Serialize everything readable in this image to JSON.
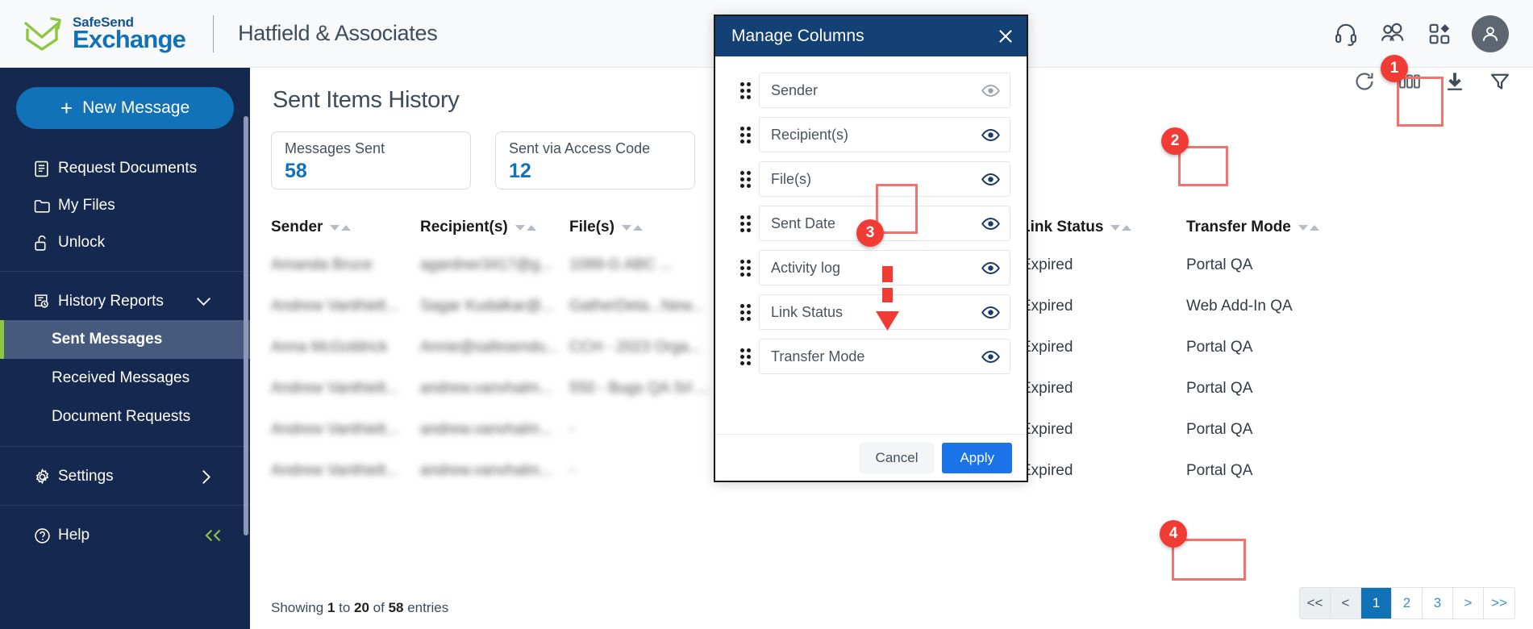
{
  "header": {
    "brand_line1": "SafeSend",
    "brand_line2": "Exchange",
    "org_name": "Hatfield & Associates",
    "icons": [
      "headset-icon",
      "users-icon",
      "apps-grid-icon",
      "avatar-icon"
    ]
  },
  "sidebar": {
    "new_message_label": "New Message",
    "items": [
      {
        "label": "Request Documents",
        "icon": "document-icon"
      },
      {
        "label": "My Files",
        "icon": "folder-icon"
      },
      {
        "label": "Unlock",
        "icon": "unlock-icon"
      }
    ],
    "history_group": {
      "label": "History Reports",
      "icon": "history-report-icon",
      "chevron": "chevron-down-icon",
      "children": [
        {
          "label": "Sent Messages",
          "active": true
        },
        {
          "label": "Received Messages",
          "active": false
        },
        {
          "label": "Document Requests",
          "active": false
        }
      ]
    },
    "settings": {
      "label": "Settings",
      "icon": "gear-icon",
      "chevron": "chevron-right-icon"
    },
    "help": {
      "label": "Help",
      "icon": "question-circle-icon",
      "collapse": "double-chevron-left-icon"
    }
  },
  "main": {
    "page_title": "Sent Items History",
    "stats": [
      {
        "label": "Messages Sent",
        "value": "58"
      },
      {
        "label": "Sent via Access Code",
        "value": "12"
      }
    ],
    "toolbar": [
      {
        "name": "refresh-icon"
      },
      {
        "name": "manage-columns-icon"
      },
      {
        "name": "download-icon"
      },
      {
        "name": "filter-icon"
      }
    ],
    "table": {
      "columns": [
        "Sender",
        "Recipient(s)",
        "File(s)",
        "Link Status",
        "Transfer Mode"
      ],
      "rows": [
        {
          "sender": "Amanda Bruce",
          "recipient": "agardner3417@g...",
          "files": "1099-G ABC ...",
          "link_status": "Expired",
          "transfer_mode": "Portal QA"
        },
        {
          "sender": "Andrew Vanthielt...",
          "recipient": "Sagar Kudalkar@...",
          "files": "GatherDeta...New...",
          "link_status": "Expired",
          "transfer_mode": "Web Add-In QA"
        },
        {
          "sender": "Anna McGoldrick",
          "recipient": "Annie@safesendu...",
          "files": "CCH - 2023 Orga...",
          "link_status": "Expired",
          "transfer_mode": "Portal QA"
        },
        {
          "sender": "Andrew Vanthielt...",
          "recipient": "andrew.vanvhalm...",
          "files": "550 - Bugs QA Srl ...",
          "link_status": "Expired",
          "transfer_mode": "Portal QA"
        },
        {
          "sender": "Andrew Vanthielt...",
          "recipient": "andrew.vanvhalm...",
          "files": "-",
          "link_status": "Expired",
          "transfer_mode": "Portal QA"
        },
        {
          "sender": "Andrew Vanthielt...",
          "recipient": "andrew.vanvhalm...",
          "files": "-",
          "link_status": "Expired",
          "transfer_mode": "Portal QA"
        }
      ]
    },
    "showing_text": {
      "prefix": "Showing ",
      "from": "1",
      "mid": " to ",
      "to": "20",
      "mid2": " of ",
      "total": "58",
      "suffix": " entries"
    },
    "pagination": {
      "first": "<<",
      "prev": "<",
      "next": ">",
      "last": ">>",
      "pages": [
        "1",
        "2",
        "3"
      ],
      "current": "1"
    }
  },
  "modal": {
    "title": "Manage Columns",
    "close_icon": "close-icon",
    "columns": [
      {
        "label": "Sender",
        "visible_icon": "eye-icon",
        "enabled": false
      },
      {
        "label": "Recipient(s)",
        "visible_icon": "eye-icon",
        "enabled": true
      },
      {
        "label": "File(s)",
        "visible_icon": "eye-icon",
        "enabled": true
      },
      {
        "label": "Sent Date",
        "visible_icon": "eye-icon",
        "enabled": true
      },
      {
        "label": "Activity log",
        "visible_icon": "eye-icon",
        "enabled": true
      },
      {
        "label": "Link Status",
        "visible_icon": "eye-icon",
        "enabled": true
      },
      {
        "label": "Transfer Mode",
        "visible_icon": "eye-icon",
        "enabled": true
      }
    ],
    "cancel_label": "Cancel",
    "apply_label": "Apply"
  },
  "annotations": [
    {
      "number": "1",
      "target": "manage-columns-toolbar-icon"
    },
    {
      "number": "2",
      "target": "recipients-eye-toggle"
    },
    {
      "number": "3",
      "target": "files-drag-handle"
    },
    {
      "number": "4",
      "target": "apply-button"
    }
  ],
  "colors": {
    "sidebar_bg": "#142850",
    "accent_blue": "#1272b8",
    "modal_header": "#134175",
    "annotation_red": "#f03c35",
    "active_green": "#8dc63f",
    "apply_blue": "#1a73e8"
  }
}
